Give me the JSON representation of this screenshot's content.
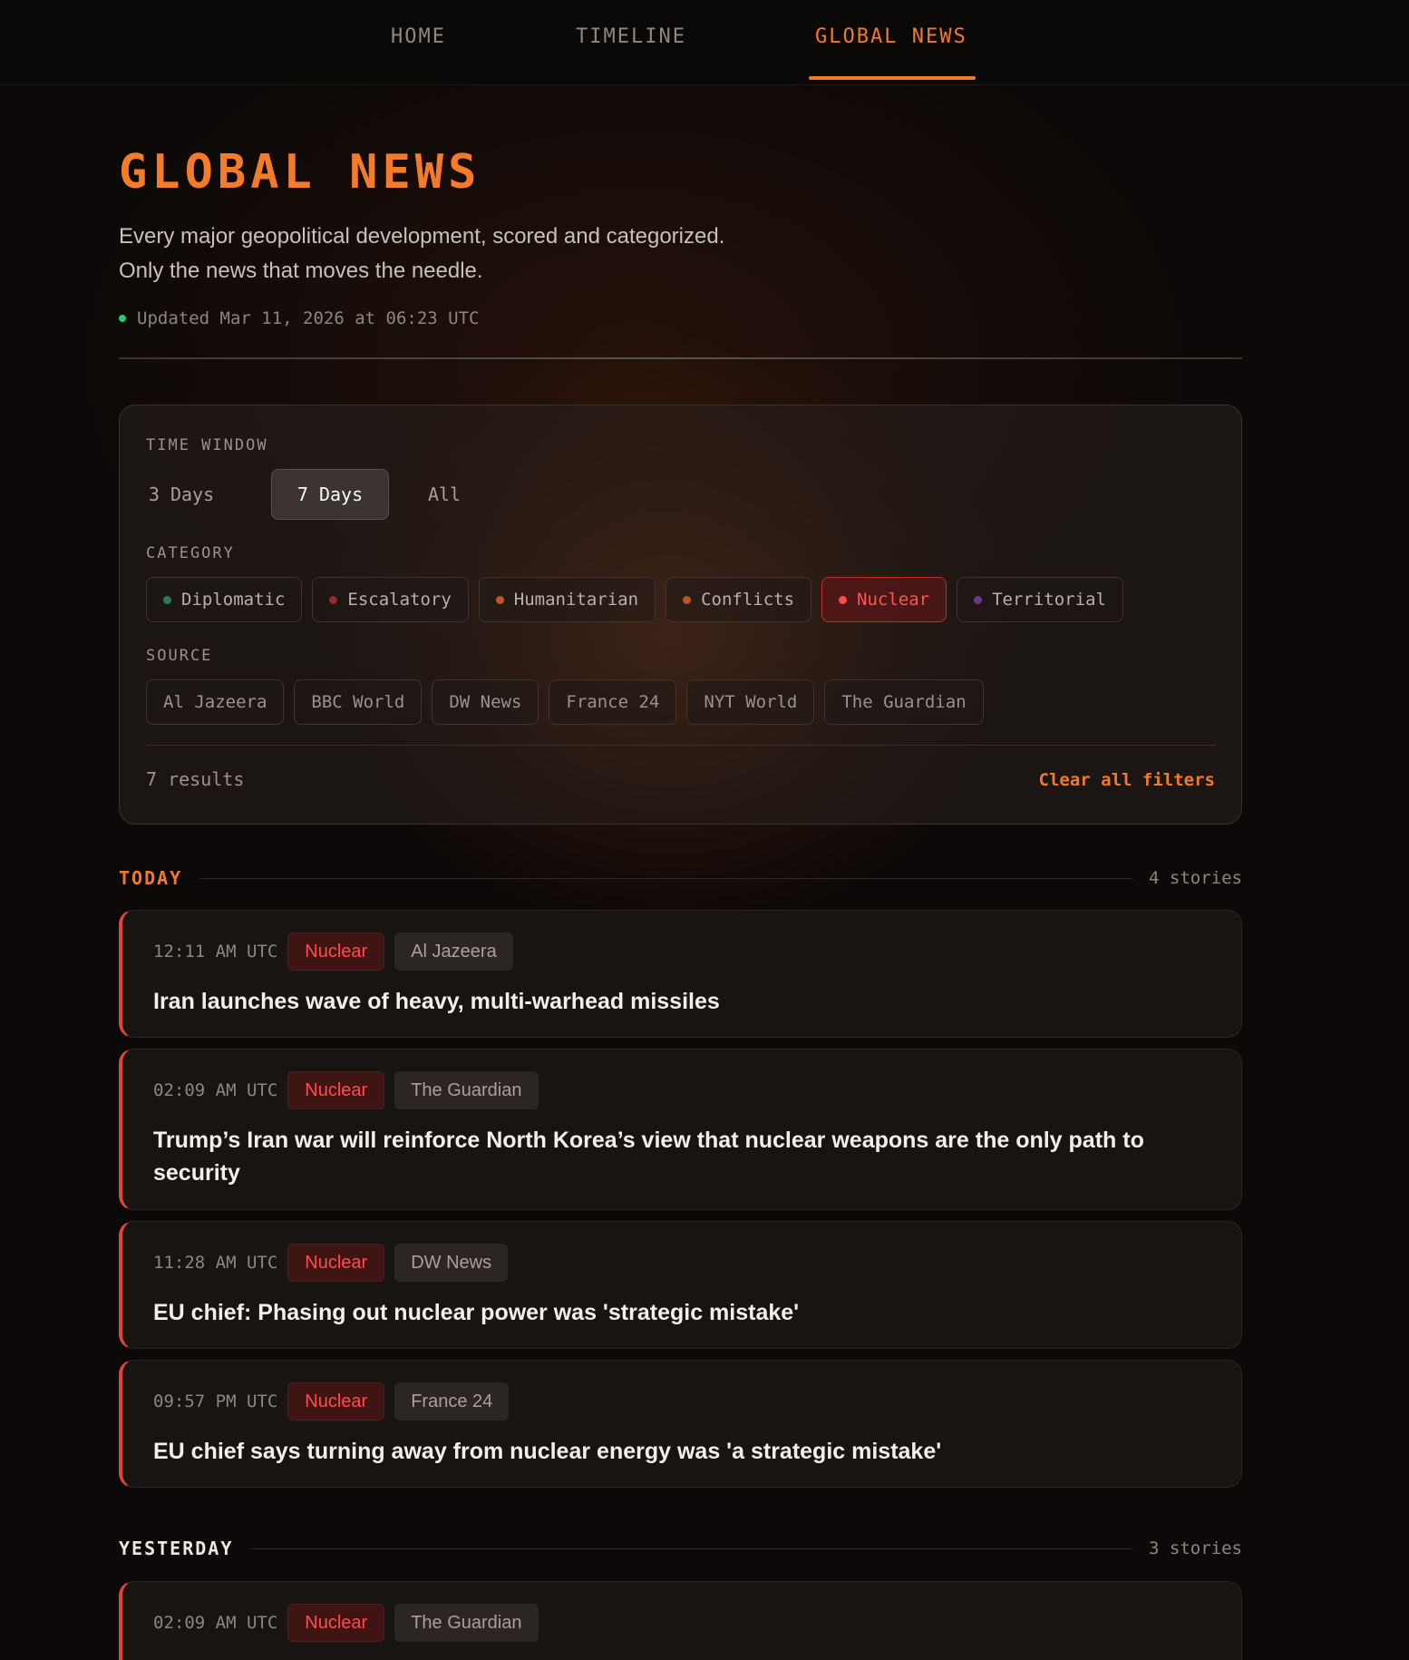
{
  "nav": {
    "items": [
      {
        "label": "HOME"
      },
      {
        "label": "TIMELINE"
      },
      {
        "label": "GLOBAL NEWS"
      }
    ]
  },
  "header": {
    "title": "GLOBAL NEWS",
    "subtitle_line1": "Every major geopolitical development, scored and categorized.",
    "subtitle_line2": "Only the news that moves the needle.",
    "updated": "Updated Mar 11, 2026 at 06:23 UTC"
  },
  "filters": {
    "time_window_label": "TIME WINDOW",
    "time_windows": [
      "3 Days",
      "7 Days",
      "All"
    ],
    "category_label": "CATEGORY",
    "categories": [
      {
        "label": "Diplomatic",
        "color": "#2f7a55"
      },
      {
        "label": "Escalatory",
        "color": "#9a2a2a"
      },
      {
        "label": "Humanitarian",
        "color": "#b85a2a"
      },
      {
        "label": "Conflicts",
        "color": "#b8561e"
      },
      {
        "label": "Nuclear",
        "color": "#ff4c4c"
      },
      {
        "label": "Territorial",
        "color": "#6a3a8a"
      }
    ],
    "source_label": "SOURCE",
    "sources": [
      "Al Jazeera",
      "BBC World",
      "DW News",
      "France 24",
      "NYT World",
      "The Guardian"
    ],
    "results": "7 results",
    "clear_label": "Clear all filters"
  },
  "groups": [
    {
      "title": "TODAY",
      "count": "4 stories",
      "stories": [
        {
          "time": "12:11 AM UTC",
          "category": "Nuclear",
          "source": "Al Jazeera",
          "title": "Iran launches wave of heavy, multi-warhead missiles"
        },
        {
          "time": "02:09 AM UTC",
          "category": "Nuclear",
          "source": "The Guardian",
          "title": "Trump’s Iran war will reinforce North Korea’s view that nuclear weapons are the only path to security"
        },
        {
          "time": "11:28 AM UTC",
          "category": "Nuclear",
          "source": "DW News",
          "title": "EU chief: Phasing out nuclear power was 'strategic mistake'"
        },
        {
          "time": "09:57 PM UTC",
          "category": "Nuclear",
          "source": "France 24",
          "title": "EU chief says turning away from nuclear energy was 'a strategic mistake'"
        }
      ]
    },
    {
      "title": "YESTERDAY",
      "count": "3 stories",
      "stories": [
        {
          "time": "02:09 AM UTC",
          "category": "Nuclear",
          "source": "The Guardian",
          "title": ""
        }
      ]
    }
  ],
  "colors": {
    "accent": "#f07a2a",
    "nuclear": "#ff4c4c",
    "updated_dot": "#2ec36a"
  }
}
